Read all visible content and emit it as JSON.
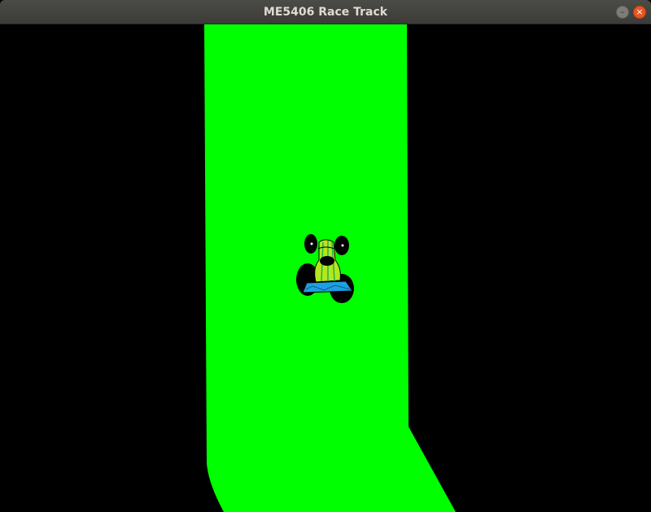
{
  "window": {
    "title": "ME5406 Race Track",
    "minimize_icon": "minimize-icon",
    "close_icon": "close-icon",
    "minimize_glyph": "–",
    "close_glyph": "×"
  },
  "game": {
    "background_color": "#000000",
    "track_color": "#00ff00",
    "car": {
      "body_color": "#b5e61d",
      "stripe_color": "#22b14c",
      "wing_color": "#1ea0e0",
      "wheel_color": "#000000"
    }
  }
}
